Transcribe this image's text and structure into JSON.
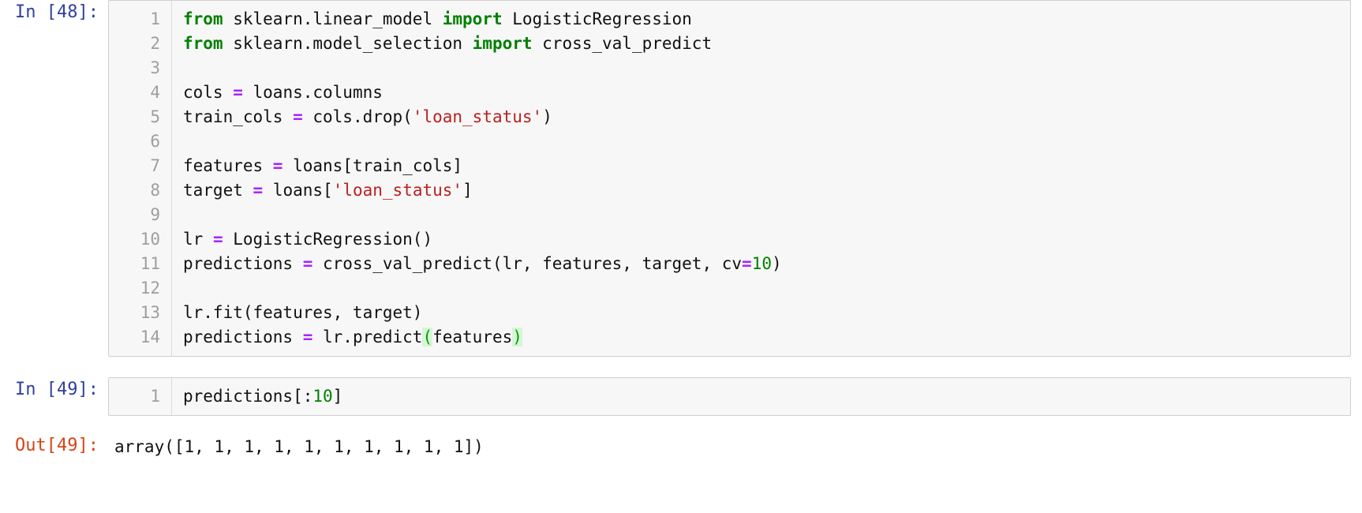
{
  "notebook": {
    "cells": [
      {
        "type": "code",
        "prompt": "In [48]:",
        "line_numbers": [
          "1",
          "2",
          "3",
          "4",
          "5",
          "6",
          "7",
          "8",
          "9",
          "10",
          "11",
          "12",
          "13",
          "14"
        ],
        "lines": [
          [
            {
              "t": "from",
              "c": "kw"
            },
            {
              "t": " sklearn.linear_model ",
              "c": "plain"
            },
            {
              "t": "import",
              "c": "kw"
            },
            {
              "t": " LogisticRegression",
              "c": "plain"
            }
          ],
          [
            {
              "t": "from",
              "c": "kw"
            },
            {
              "t": " sklearn.model_selection ",
              "c": "plain"
            },
            {
              "t": "import",
              "c": "kw"
            },
            {
              "t": " cross_val_predict",
              "c": "plain"
            }
          ],
          [],
          [
            {
              "t": "cols ",
              "c": "plain"
            },
            {
              "t": "=",
              "c": "op"
            },
            {
              "t": " loans.columns",
              "c": "plain"
            }
          ],
          [
            {
              "t": "train_cols ",
              "c": "plain"
            },
            {
              "t": "=",
              "c": "op"
            },
            {
              "t": " cols.drop(",
              "c": "plain"
            },
            {
              "t": "'loan_status'",
              "c": "str"
            },
            {
              "t": ")",
              "c": "plain"
            }
          ],
          [],
          [
            {
              "t": "features ",
              "c": "plain"
            },
            {
              "t": "=",
              "c": "op"
            },
            {
              "t": " loans[train_cols]",
              "c": "plain"
            }
          ],
          [
            {
              "t": "target ",
              "c": "plain"
            },
            {
              "t": "=",
              "c": "op"
            },
            {
              "t": " loans[",
              "c": "plain"
            },
            {
              "t": "'loan_status'",
              "c": "str"
            },
            {
              "t": "]",
              "c": "plain"
            }
          ],
          [],
          [
            {
              "t": "lr ",
              "c": "plain"
            },
            {
              "t": "=",
              "c": "op"
            },
            {
              "t": " LogisticRegression()",
              "c": "plain"
            }
          ],
          [
            {
              "t": "predictions ",
              "c": "plain"
            },
            {
              "t": "=",
              "c": "op"
            },
            {
              "t": " cross_val_predict(lr, features, target, cv",
              "c": "plain"
            },
            {
              "t": "=",
              "c": "op"
            },
            {
              "t": "10",
              "c": "num"
            },
            {
              "t": ")",
              "c": "plain"
            }
          ],
          [],
          [
            {
              "t": "lr.fit(features, target)",
              "c": "plain"
            }
          ],
          [
            {
              "t": "predictions ",
              "c": "plain"
            },
            {
              "t": "=",
              "c": "op"
            },
            {
              "t": " lr.predict",
              "c": "plain"
            },
            {
              "t": "(",
              "c": "bracket"
            },
            {
              "t": "features",
              "c": "plain"
            },
            {
              "t": ")",
              "c": "bracket"
            }
          ]
        ]
      },
      {
        "type": "code",
        "prompt": "In [49]:",
        "line_numbers": [
          "1"
        ],
        "lines": [
          [
            {
              "t": "predictions[:",
              "c": "plain"
            },
            {
              "t": "10",
              "c": "num"
            },
            {
              "t": "]",
              "c": "plain"
            }
          ]
        ]
      },
      {
        "type": "output",
        "prompt": "Out[49]:",
        "text": "array([1, 1, 1, 1, 1, 1, 1, 1, 1, 1])"
      }
    ]
  },
  "theme": {
    "prompt_in_color": "#303f9f",
    "prompt_out_color": "#d84315",
    "keyword_color": "#008000",
    "operator_color": "#aa22ff",
    "string_color": "#ba2121",
    "number_color": "#008000",
    "bracket_match_color": "#00a000",
    "editor_background": "#f7f7f7",
    "editor_border": "#cfcfcf",
    "gutter_text_color": "#9e9e9e",
    "page_background": "#ffffff"
  }
}
